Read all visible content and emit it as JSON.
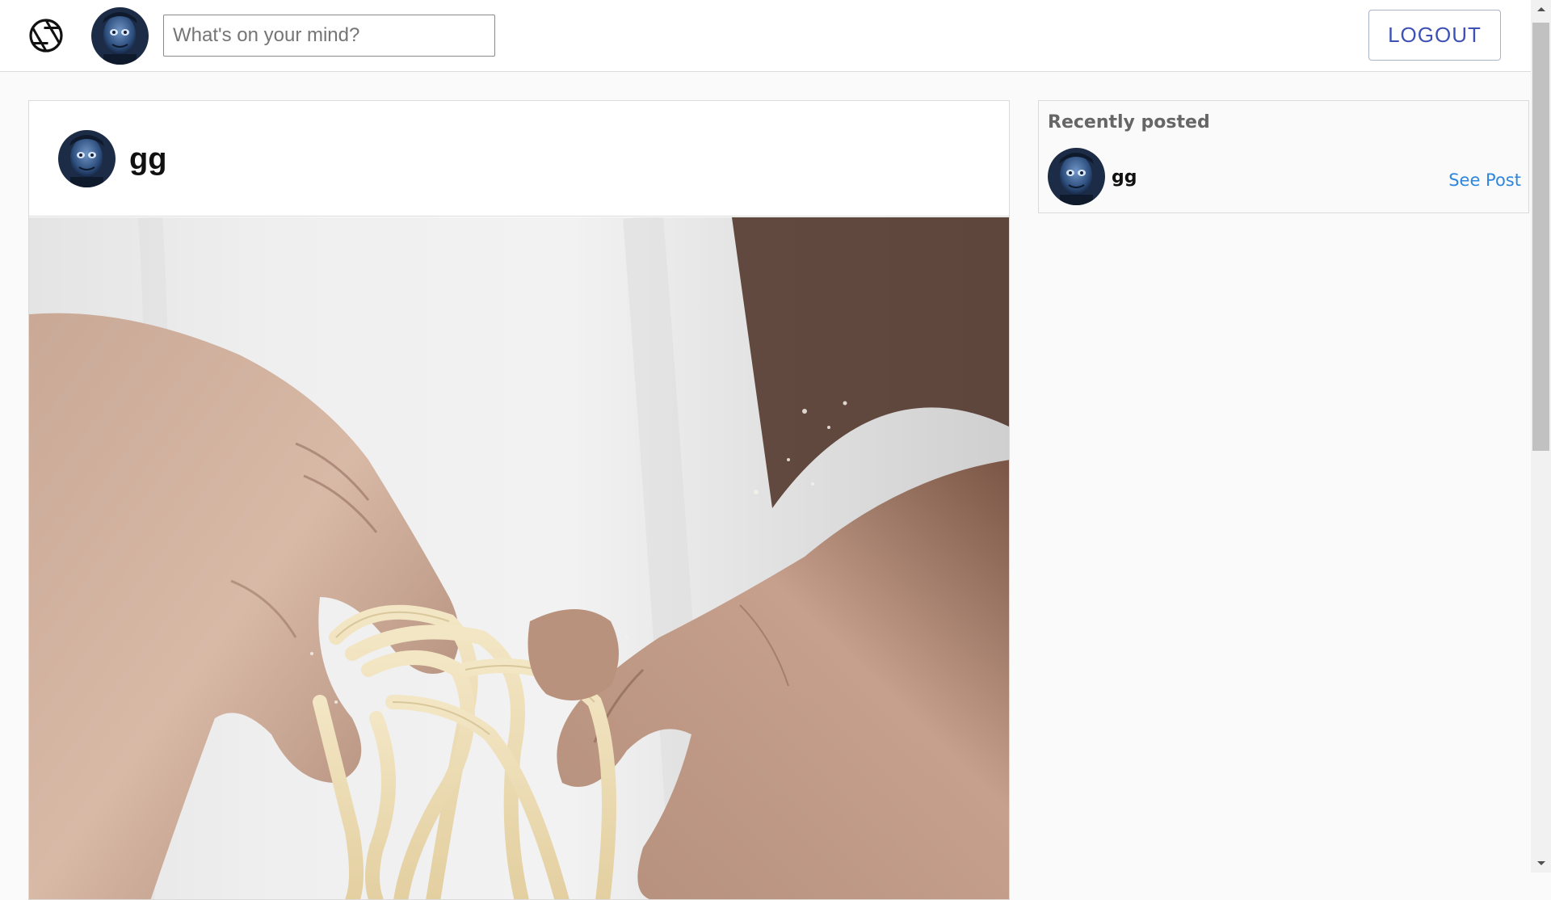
{
  "header": {
    "logo_icon": "camera-aperture-icon",
    "search": {
      "placeholder": "What's on your mind?",
      "value": ""
    },
    "logout_label": "LOGOUT"
  },
  "post": {
    "username": "gg",
    "image_description_icon": "photo"
  },
  "sidebar": {
    "title": "Recently posted",
    "items": [
      {
        "username": "gg",
        "link_label": "See Post"
      }
    ]
  },
  "colors": {
    "accent": "#3f51b5",
    "link": "#2f86de",
    "border": "#dbdbdb",
    "page_bg": "#fafafa"
  }
}
